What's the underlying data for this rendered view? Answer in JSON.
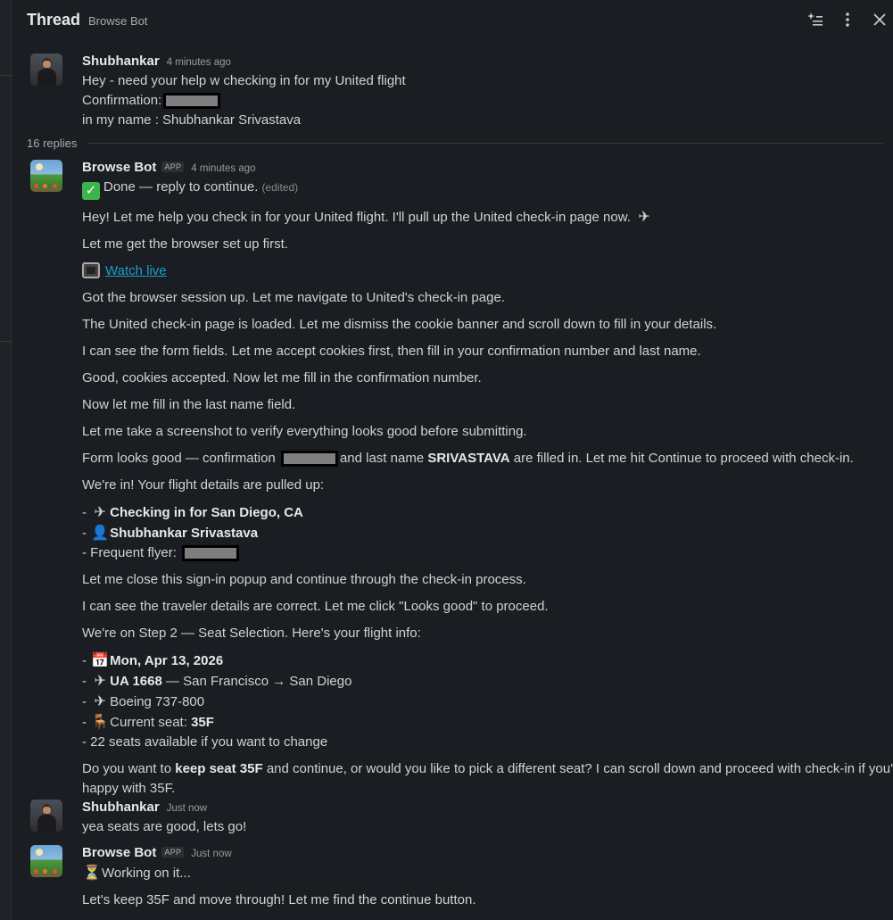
{
  "header": {
    "title": "Thread",
    "subtitle": "Browse Bot",
    "icons": [
      "ai-sparkle-list-icon",
      "more-vertical-icon",
      "close-icon"
    ]
  },
  "root_message": {
    "author": "Shubhankar",
    "time": "4 minutes ago",
    "line1": "Hey - need your help w checking in for my United flight",
    "line2": "Confirmation:",
    "line3": "in my name : Shubhankar Srivastava"
  },
  "replies_label": "16 replies",
  "bot_message_1": {
    "author": "Browse Bot",
    "badge": "APP",
    "time": "4 minutes ago",
    "status": "Done — reply to continue.",
    "edited": "(edited)",
    "p1": "Hey! Let me help you check in for your United flight. I'll pull up the United check-in page now.",
    "p2": "Let me get the browser set up first.",
    "watch_live": "Watch live",
    "p3": "Got the browser session up. Let me navigate to United's check-in page.",
    "p4": "The United check-in page is loaded. Let me dismiss the cookie banner and scroll down to fill in your details.",
    "p5": "I can see the form fields. Let me accept cookies first, then fill in your confirmation number and last name.",
    "p6": "Good, cookies accepted. Now let me fill in the confirmation number.",
    "p7": "Now let me fill in the last name field.",
    "p8": "Let me take a screenshot to verify everything looks good before submitting.",
    "p9_a": "Form looks good — confirmation",
    "p9_b": "and last name",
    "p9_bold": "SRIVASTAVA",
    "p9_c": "are filled in. Let me hit Continue to proceed with check-in.",
    "p10": "We're in! Your flight details are pulled up:",
    "flight_destination": "Checking in for San Diego, CA",
    "passenger_name": "Shubhankar Srivastava",
    "frequent_flyer_label": "Frequent flyer:",
    "p11": "Let me close this sign-in popup and continue through the check-in process.",
    "p12": "I can see the traveler details are correct. Let me click \"Looks good\" to proceed.",
    "p13": "We're on Step 2 — Seat Selection. Here's your flight info:",
    "flight_date": "Mon, Apr 13, 2026",
    "flight_number": "UA 1668",
    "route": "— San Francisco → San Diego",
    "aircraft": "Boeing 737-800",
    "current_seat_label": "Current seat:",
    "current_seat": "35F",
    "seats_available": "22 seats available if you want to change",
    "p14_a": "Do you want to",
    "p14_bold": "keep seat 35F",
    "p14_b": "and continue, or would you like to pick a different seat? I can scroll down and proceed with check-in if you're",
    "p14_c": "happy with 35F."
  },
  "user_message_2": {
    "author": "Shubhankar",
    "time": "Just now",
    "text": "yea seats are good, lets go!"
  },
  "bot_message_2": {
    "author": "Browse Bot",
    "badge": "APP",
    "time": "Just now",
    "status": "Working on it...",
    "text": "Let's keep 35F and move through! Let me find the continue button."
  },
  "colors": {
    "background": "#1a1d21",
    "text": "#d1d2d3",
    "link": "#1d9bd1",
    "success": "#3bb54a"
  }
}
